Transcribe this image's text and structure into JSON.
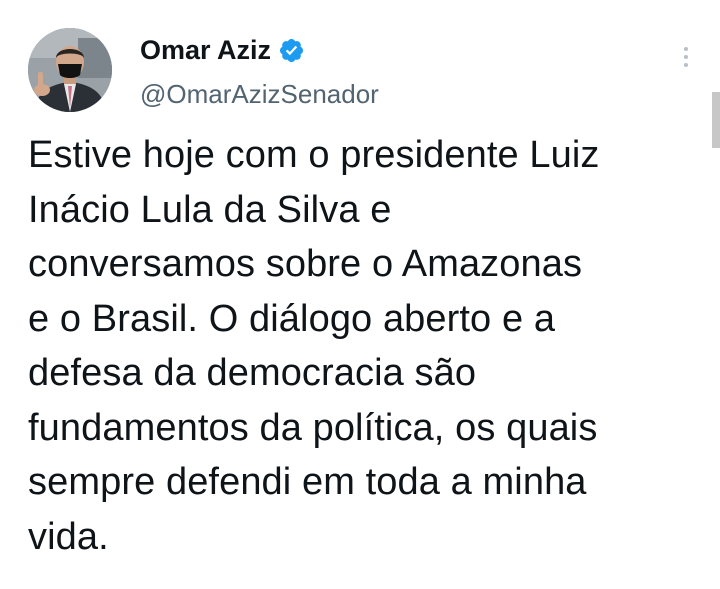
{
  "tweet": {
    "author": {
      "display_name": "Omar Aziz",
      "handle": "@OmarAzizSenador",
      "verified": true,
      "avatar_icon": "profile-photo"
    },
    "text": "Estive hoje com o presidente Luiz\nInácio Lula da Silva e\nconversamos sobre o Amazonas\ne o Brasil. O diálogo aberto e a\ndefesa da democracia são\nfundamentos da política, os quais\nsempre defendi em toda a minha\nvida.",
    "menu_icon": "more-vertical-icon"
  },
  "colors": {
    "text_primary": "#0f1419",
    "text_secondary": "#536471",
    "verified_blue": "#1d9bf0",
    "menu_dots": "#b8c0c7"
  }
}
